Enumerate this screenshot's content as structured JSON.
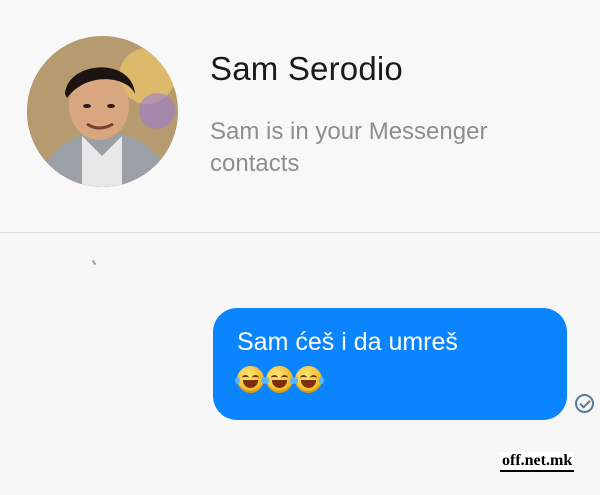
{
  "contact": {
    "name": "Sam Serodio",
    "subtitle": "Sam is in your Messenger contacts"
  },
  "message": {
    "text": "Sam ćeš i da umreš",
    "emojis": [
      "face-with-tears-of-joy-icon",
      "face-with-tears-of-joy-icon",
      "face-with-tears-of-joy-icon"
    ],
    "status": "seen",
    "bubble_color": "#0a84ff"
  },
  "watermark": "off.net.mk",
  "colors": {
    "background": "#f7f7f7",
    "name_text": "#1a1a1a",
    "subtitle_text": "#8e8e8e"
  }
}
